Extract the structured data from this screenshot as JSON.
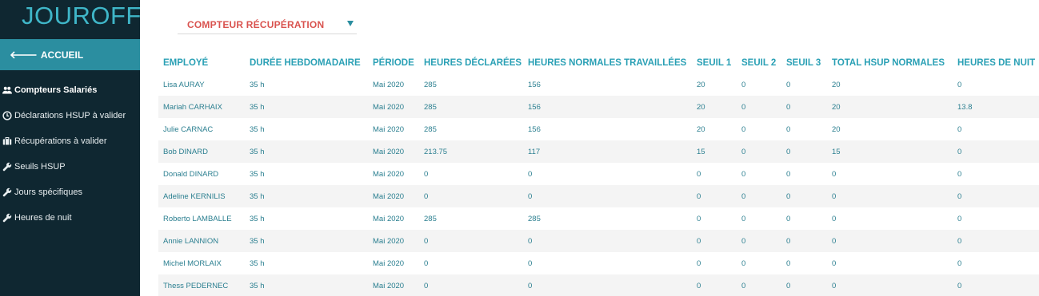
{
  "app": {
    "brand": "JOUROFF"
  },
  "sidebar": {
    "home_label": "ACCUEIL",
    "items": [
      {
        "label": "Compteurs Salariés",
        "icon": "users-icon",
        "active": true
      },
      {
        "label": "Déclarations HSUP à valider",
        "icon": "clock-icon",
        "active": false
      },
      {
        "label": "Récupérations à valider",
        "icon": "briefcase-icon",
        "active": false
      },
      {
        "label": "Seuils HSUP",
        "icon": "wrench-icon",
        "active": false
      },
      {
        "label": "Jours spécifiques",
        "icon": "wrench-icon",
        "active": false
      },
      {
        "label": "Heures de nuit",
        "icon": "wrench-icon",
        "active": false
      }
    ]
  },
  "selector": {
    "value": "COMPTEUR RÉCUPÉRATION"
  },
  "table": {
    "columns": [
      "EMPLOYÉ",
      "DURÉE HEBDOMADAIRE",
      "PÉRIODE",
      "HEURES DÉCLARÉES",
      "HEURES NORMALES TRAVAILLÉES",
      "SEUIL 1",
      "SEUIL 2",
      "SEUIL 3",
      "TOTAL HSUP NORMALES",
      "HEURES DE NUIT"
    ],
    "rows": [
      [
        "Lisa AURAY",
        "35 h",
        "Mai 2020",
        "285",
        "156",
        "20",
        "0",
        "0",
        "20",
        "0"
      ],
      [
        "Mariah CARHAIX",
        "35 h",
        "Mai 2020",
        "285",
        "156",
        "20",
        "0",
        "0",
        "20",
        "13.8"
      ],
      [
        "Julie CARNAC",
        "35 h",
        "Mai 2020",
        "285",
        "156",
        "20",
        "0",
        "0",
        "20",
        "0"
      ],
      [
        "Bob DINARD",
        "35 h",
        "Mai 2020",
        "213.75",
        "117",
        "15",
        "0",
        "0",
        "15",
        "0"
      ],
      [
        "Donald DINARD",
        "35 h",
        "Mai 2020",
        "0",
        "0",
        "0",
        "0",
        "0",
        "0",
        "0"
      ],
      [
        "Adeline KERNILIS",
        "35 h",
        "Mai 2020",
        "0",
        "0",
        "0",
        "0",
        "0",
        "0",
        "0"
      ],
      [
        "Roberto LAMBALLE",
        "35 h",
        "Mai 2020",
        "285",
        "285",
        "0",
        "0",
        "0",
        "0",
        "0"
      ],
      [
        "Annie LANNION",
        "35 h",
        "Mai 2020",
        "0",
        "0",
        "0",
        "0",
        "0",
        "0",
        "0"
      ],
      [
        "Michel MORLAIX",
        "35 h",
        "Mai 2020",
        "0",
        "0",
        "0",
        "0",
        "0",
        "0",
        "0"
      ],
      [
        "Thess PEDERNEC",
        "35 h",
        "Mai 2020",
        "0",
        "0",
        "0",
        "0",
        "0",
        "0",
        "0"
      ]
    ]
  },
  "colors": {
    "sidebar_bg": "#0f2731",
    "accent": "#2b8ea0",
    "header_text": "#2aa0b5",
    "selector_text": "#d9534f"
  }
}
